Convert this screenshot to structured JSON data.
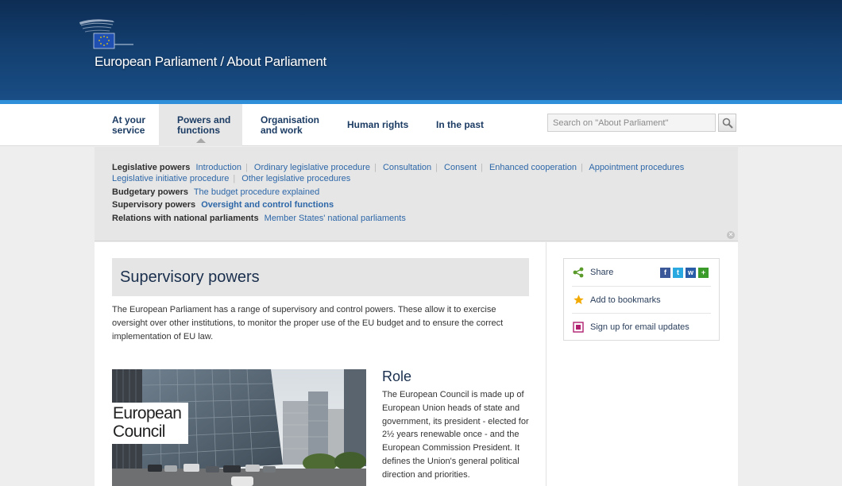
{
  "header": {
    "title": "European Parliament / About Parliament"
  },
  "nav": {
    "items": [
      {
        "line1": "At your",
        "line2": "service"
      },
      {
        "line1": "Powers and",
        "line2": "functions"
      },
      {
        "line1": "Organisation",
        "line2": "and work"
      },
      {
        "line1": "Human rights",
        "line2": ""
      },
      {
        "line1": "In the past",
        "line2": ""
      }
    ],
    "active_index": 1
  },
  "search": {
    "placeholder": "Search on \"About Parliament\""
  },
  "submenu": {
    "legislative": {
      "heading": "Legislative powers",
      "links": [
        "Introduction",
        "Ordinary legislative procedure",
        "Consultation",
        "Consent",
        "Enhanced cooperation",
        "Appointment procedures",
        "Legislative initiative procedure",
        "Other legislative procedures"
      ]
    },
    "budgetary": {
      "heading": "Budgetary powers",
      "links": [
        "The budget procedure explained"
      ]
    },
    "supervisory": {
      "heading": "Supervisory powers",
      "links": [
        "Oversight and control functions"
      ]
    },
    "relations": {
      "heading": "Relations with national parliaments",
      "links": [
        "Member States' national parliaments"
      ]
    }
  },
  "main": {
    "title": "Supervisory powers",
    "intro": "The European Parliament has a range of supervisory and control powers. These allow it to exercise oversight over other institutions, to monitor the proper use of the EU budget and to ensure the correct implementation of EU law.",
    "photo_caption_line1": "European",
    "photo_caption_line2": "Council",
    "role_title": "Role",
    "role_text": "The European Council is made up of European Union heads of state and government, its president - elected for 2½ years renewable once - and the European Commission President. It defines the Union's general political direction and priorities."
  },
  "sidebar": {
    "share_label": "Share",
    "bookmarks_label": "Add to bookmarks",
    "email_label": "Sign up for email updates",
    "social": [
      {
        "icon": "facebook-icon",
        "glyph": "f",
        "color": "#3b5998"
      },
      {
        "icon": "twitter-icon",
        "glyph": "t",
        "color": "#2aa9e0"
      },
      {
        "icon": "windows-live-icon",
        "glyph": "w",
        "color": "#2a5da8"
      },
      {
        "icon": "more-share-icon",
        "glyph": "+",
        "color": "#3a9a2a"
      }
    ]
  }
}
